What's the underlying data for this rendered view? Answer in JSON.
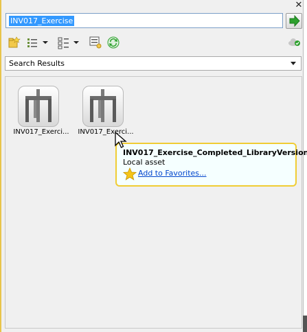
{
  "search": {
    "value": "INV017_Exercise"
  },
  "view_select": {
    "value": "Search Results"
  },
  "assets": [
    {
      "label": "INV017_Exerci..."
    },
    {
      "label": "INV017_Exerci..."
    }
  ],
  "tooltip": {
    "title": "INV017_Exercise_Completed_LibraryVersion",
    "subtitle": "Local asset",
    "link": "Add to Favorites..."
  },
  "icons": {
    "close": "close-icon",
    "go": "go-arrow-icon",
    "new_folder": "new-folder-icon",
    "list_view": "list-view-icon",
    "filter": "filter-options-icon",
    "properties": "properties-icon",
    "refresh": "refresh-icon",
    "cloud": "cloud-status-icon",
    "favorite": "star-icon"
  },
  "colors": {
    "accent": "#e8c44a",
    "selection": "#3399ff",
    "link": "#0044cc",
    "go_green": "#2ea02e"
  }
}
